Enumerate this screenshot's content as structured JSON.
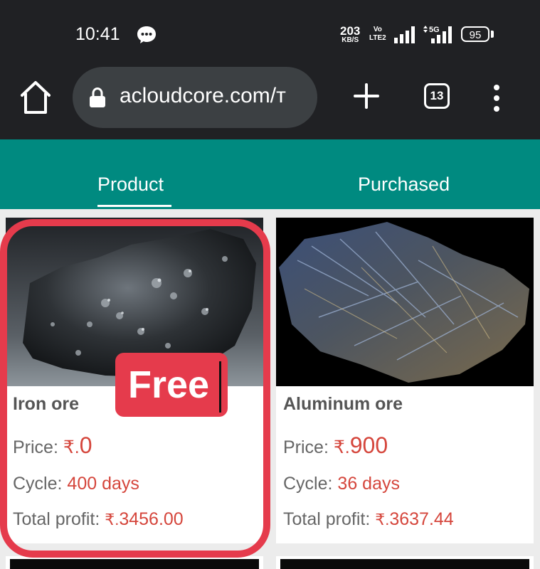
{
  "status_bar": {
    "time": "10:41",
    "net_speed_value": "203",
    "net_speed_unit": "KB/S",
    "volte_top": "Vo",
    "volte_bottom": "LTE2",
    "network_label": "5G",
    "battery": "95"
  },
  "browser": {
    "url": "acloudcore.com/т",
    "tab_count": "13"
  },
  "tabs": [
    {
      "label": "Product",
      "active": true
    },
    {
      "label": "Purchased",
      "active": false
    }
  ],
  "products": [
    {
      "name": "Iron ore",
      "price_label": "Price:",
      "currency": "₹.",
      "price": "0",
      "cycle_label": "Cycle:",
      "cycle": "400 days",
      "profit_label": "Total profit:",
      "profit": "3456.00"
    },
    {
      "name": "Aluminum ore",
      "price_label": "Price:",
      "currency": "₹.",
      "price": "900",
      "cycle_label": "Cycle:",
      "cycle": "36 days",
      "profit_label": "Total profit:",
      "profit": "3637.44"
    }
  ],
  "annotation": {
    "badge": "Free",
    "color": "#e53b4c"
  },
  "colors": {
    "chrome_bg": "#202124",
    "tabbar_bg": "#008a80",
    "accent_value": "#d5463c"
  }
}
